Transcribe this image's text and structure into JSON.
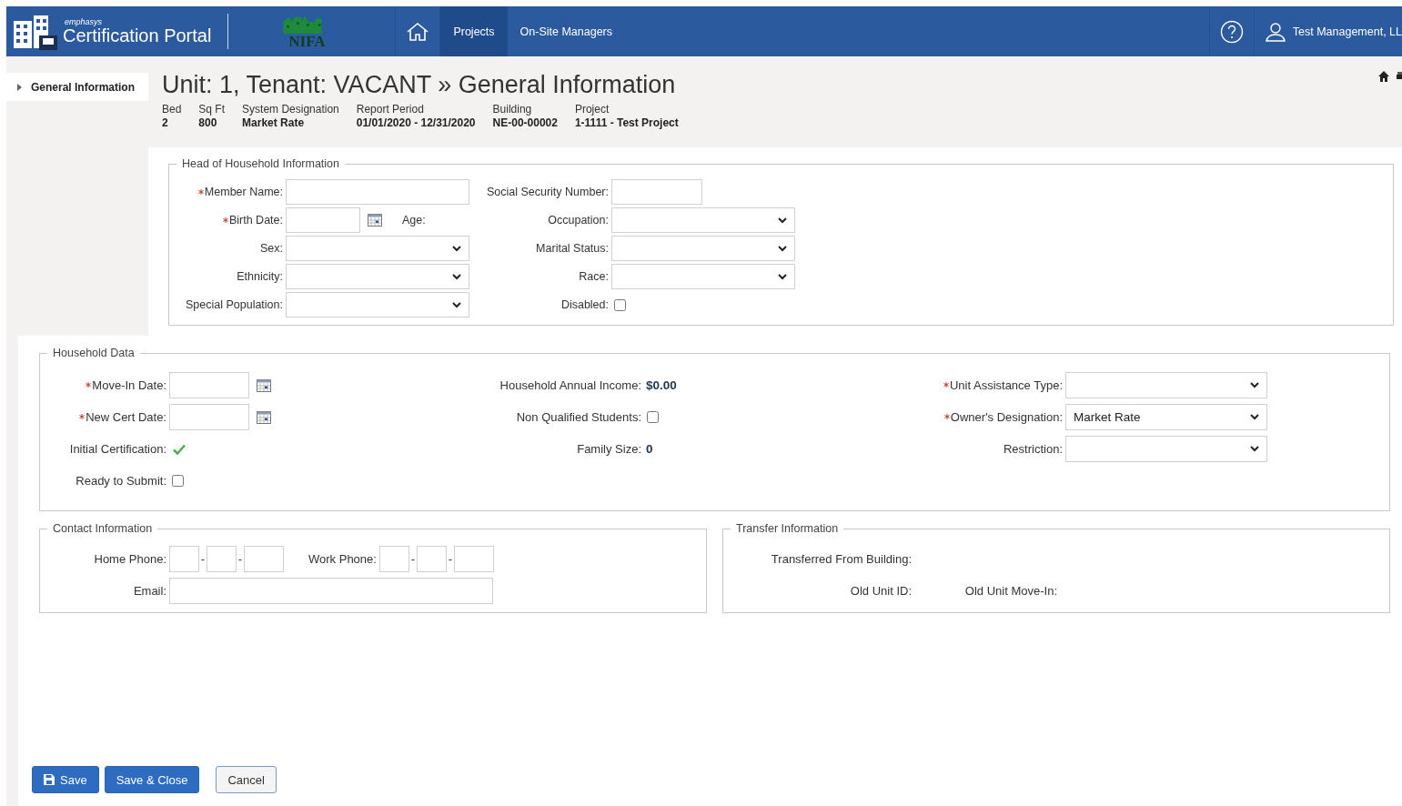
{
  "header": {
    "brand_tagline": "emphasys",
    "brand": "Certification Portal",
    "partner_logo": "NIFA",
    "nav": [
      {
        "label": "Projects",
        "selected": true
      },
      {
        "label": "On-Site Managers",
        "selected": false
      }
    ],
    "user": "Test Management, LL"
  },
  "sidebar": [
    {
      "label": "General Information",
      "selected": true
    }
  ],
  "page": {
    "title": "Unit: 1, Tenant: VACANT » General Information",
    "summary": [
      {
        "label": "Bed",
        "value": "2"
      },
      {
        "label": "Sq Ft",
        "value": "800"
      },
      {
        "label": "System Designation",
        "value": "Market Rate"
      },
      {
        "label": "Report Period",
        "value": "01/01/2020 - 12/31/2020"
      },
      {
        "label": "Building",
        "value": "NE-00-00002"
      },
      {
        "label": "Project",
        "value": "1-1111 - Test Project"
      }
    ]
  },
  "head_of_household": {
    "legend": "Head of Household Information",
    "columns": [
      [
        {
          "label": "Member Name:",
          "kind": "text",
          "required": true
        },
        {
          "label": "Birth Date:",
          "kind": "date",
          "required": true,
          "note": "Age:"
        },
        {
          "label": "Sex:",
          "kind": "select",
          "required": false
        },
        {
          "label": "Ethnicity:",
          "kind": "select",
          "required": false
        },
        {
          "label": "Special Population:",
          "kind": "select",
          "required": false
        }
      ],
      [
        {
          "label": "Social Security Number:",
          "kind": "short-text",
          "required": false
        },
        {
          "label": "Occupation:",
          "kind": "select",
          "required": false
        },
        {
          "label": "Marital Status:",
          "kind": "select",
          "required": false
        },
        {
          "label": "Race:",
          "kind": "select",
          "required": false
        },
        {
          "label": "Disabled:",
          "kind": "checkbox",
          "required": false,
          "checked": false
        }
      ]
    ]
  },
  "household_data": {
    "legend": "Household Data",
    "columns": [
      [
        {
          "label": "Move-In Date:",
          "kind": "date",
          "required": true
        },
        {
          "label": "New Cert Date:",
          "kind": "date",
          "required": true
        },
        {
          "label": "Initial Certification:",
          "kind": "tick",
          "required": false,
          "checked": true
        },
        {
          "label": "Ready to Submit:",
          "kind": "checkbox",
          "required": false,
          "checked": false
        }
      ],
      [
        {
          "label": "Household Annual Income:",
          "kind": "readout",
          "required": false,
          "value": "$0.00"
        },
        {
          "label": "Non Qualified Students:",
          "kind": "checkbox",
          "required": false,
          "checked": false
        },
        {
          "label": "Family Size:",
          "kind": "readout",
          "required": false,
          "value": "0"
        }
      ],
      [
        {
          "label": "Unit Assistance Type:",
          "kind": "select",
          "required": true
        },
        {
          "label": "Owner's Designation:",
          "kind": "select",
          "required": true,
          "value": "Market Rate"
        },
        {
          "label": "Restriction:",
          "kind": "select",
          "required": false
        }
      ]
    ]
  },
  "contact": {
    "legend": "Contact Information",
    "rows": [
      [
        {
          "label": "Home Phone:",
          "kind": "phone",
          "separators": [
            "-",
            "-"
          ]
        },
        {
          "label": "Work Phone:",
          "kind": "phone",
          "separators": [
            "-",
            "-"
          ]
        }
      ],
      [
        {
          "label": "Email:",
          "kind": "email"
        }
      ]
    ]
  },
  "transfer": {
    "legend": "Transfer Information",
    "fields": [
      {
        "label": "Transferred From Building:"
      },
      {
        "label": "Old Unit ID:"
      },
      {
        "label": "Old Unit Move-In:"
      }
    ]
  },
  "buttons": [
    {
      "label": "Save",
      "kind": "save"
    },
    {
      "label": "Save & Close",
      "kind": "primary"
    },
    {
      "label": "Cancel",
      "kind": "secondary"
    }
  ]
}
